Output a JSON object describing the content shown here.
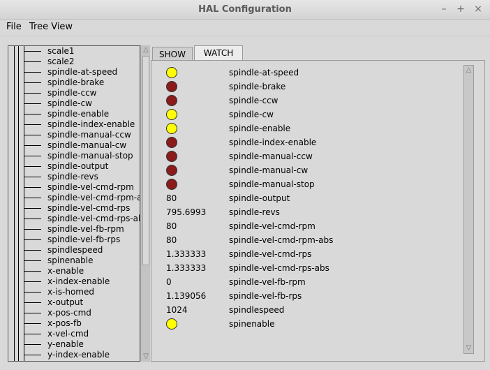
{
  "window": {
    "title": "HAL Configuration",
    "min_glyph": "–",
    "max_glyph": "+",
    "close_glyph": "×"
  },
  "menu": {
    "file": "File",
    "tree_view": "Tree View"
  },
  "tree": {
    "items": [
      "scale1",
      "scale2",
      "spindle-at-speed",
      "spindle-brake",
      "spindle-ccw",
      "spindle-cw",
      "spindle-enable",
      "spindle-index-enable",
      "spindle-manual-ccw",
      "spindle-manual-cw",
      "spindle-manual-stop",
      "spindle-output",
      "spindle-revs",
      "spindle-vel-cmd-rpm",
      "spindle-vel-cmd-rpm-a",
      "spindle-vel-cmd-rps",
      "spindle-vel-cmd-rps-al",
      "spindle-vel-fb-rpm",
      "spindle-vel-fb-rps",
      "spindlespeed",
      "spinenable",
      "x-enable",
      "x-index-enable",
      "x-is-homed",
      "x-output",
      "x-pos-cmd",
      "x-pos-fb",
      "x-vel-cmd",
      "y-enable",
      "y-index-enable"
    ]
  },
  "scroll": {
    "up_glyph": "△",
    "down_glyph": "▽"
  },
  "tabs": {
    "show": "SHOW",
    "watch": "WATCH"
  },
  "colors": {
    "led_on": "#ffff00",
    "led_off": "#8b1a1a"
  },
  "watch": [
    {
      "name": "spindle-at-speed",
      "type": "led",
      "on": true
    },
    {
      "name": "spindle-brake",
      "type": "led",
      "on": false
    },
    {
      "name": "spindle-ccw",
      "type": "led",
      "on": false
    },
    {
      "name": "spindle-cw",
      "type": "led",
      "on": true
    },
    {
      "name": "spindle-enable",
      "type": "led",
      "on": true
    },
    {
      "name": "spindle-index-enable",
      "type": "led",
      "on": false
    },
    {
      "name": "spindle-manual-ccw",
      "type": "led",
      "on": false
    },
    {
      "name": "spindle-manual-cw",
      "type": "led",
      "on": false
    },
    {
      "name": "spindle-manual-stop",
      "type": "led",
      "on": false
    },
    {
      "name": "spindle-output",
      "type": "value",
      "value": "80"
    },
    {
      "name": "spindle-revs",
      "type": "value",
      "value": "795.6993"
    },
    {
      "name": "spindle-vel-cmd-rpm",
      "type": "value",
      "value": "80"
    },
    {
      "name": "spindle-vel-cmd-rpm-abs",
      "type": "value",
      "value": "80"
    },
    {
      "name": "spindle-vel-cmd-rps",
      "type": "value",
      "value": "1.333333"
    },
    {
      "name": "spindle-vel-cmd-rps-abs",
      "type": "value",
      "value": "1.333333"
    },
    {
      "name": "spindle-vel-fb-rpm",
      "type": "value",
      "value": "0"
    },
    {
      "name": "spindle-vel-fb-rps",
      "type": "value",
      "value": "1.139056"
    },
    {
      "name": "spindlespeed",
      "type": "value",
      "value": "1024"
    },
    {
      "name": "spinenable",
      "type": "led",
      "on": true
    }
  ]
}
